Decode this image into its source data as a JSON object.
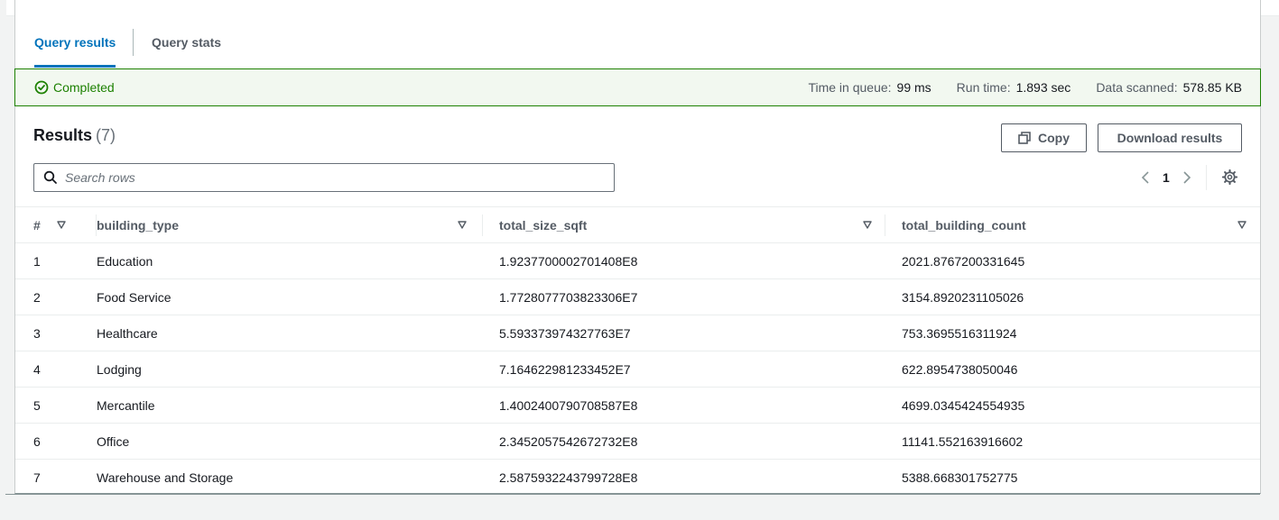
{
  "tabs": [
    {
      "label": "Query results",
      "active": true
    },
    {
      "label": "Query stats",
      "active": false
    }
  ],
  "status": {
    "label": "Completed",
    "color": "#1d8102",
    "time_in_queue_label": "Time in queue:",
    "time_in_queue_value": "99 ms",
    "run_time_label": "Run time:",
    "run_time_value": "1.893 sec",
    "data_scanned_label": "Data scanned:",
    "data_scanned_value": "578.85 KB"
  },
  "results": {
    "title": "Results",
    "count": "(7)",
    "copy_label": "Copy",
    "download_label": "Download results",
    "search_placeholder": "Search rows",
    "page": "1"
  },
  "table": {
    "columns": [
      "#",
      "building_type",
      "total_size_sqft",
      "total_building_count"
    ],
    "rows": [
      [
        "1",
        "Education",
        "1.9237700002701408E8",
        "2021.8767200331645"
      ],
      [
        "2",
        "Food Service",
        "1.7728077703823306E7",
        "3154.8920231105026"
      ],
      [
        "3",
        "Healthcare",
        "5.593373974327763E7",
        "753.3695516311924"
      ],
      [
        "4",
        "Lodging",
        "7.164622981233452E7",
        "622.8954738050046"
      ],
      [
        "5",
        "Mercantile",
        "1.4002400790708587E8",
        "4699.0345424554935"
      ],
      [
        "6",
        "Office",
        "2.3452057542672732E8",
        "11141.552163916602"
      ],
      [
        "7",
        "Warehouse and Storage",
        "2.5875932243799728E8",
        "5388.668301752775"
      ]
    ]
  },
  "colors": {
    "accent": "#0073bb",
    "success": "#1d8102"
  }
}
